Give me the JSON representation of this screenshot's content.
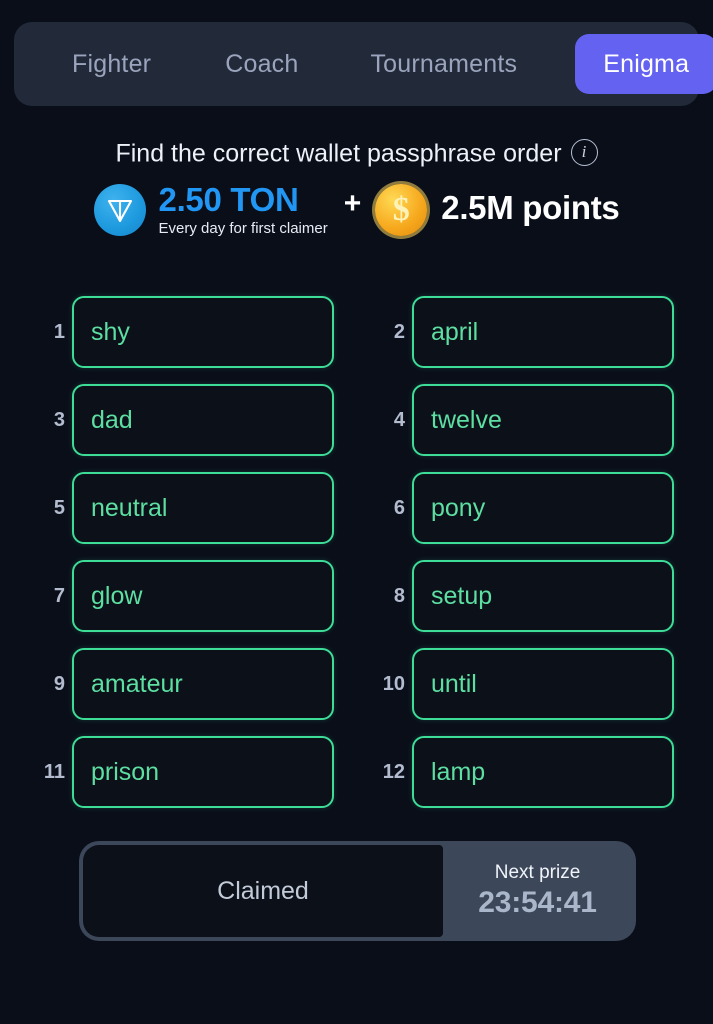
{
  "theme": {
    "background": "#0a0e19",
    "tabbar_bg": "#222a3a",
    "accent_indigo": "#6462f0",
    "accent_green": "#3ddc97",
    "word_text": "#5ddfa2",
    "ton_blue": "#2196f3",
    "coin_gold": "#f6a81d",
    "slate": "#3c4759"
  },
  "tabs": [
    {
      "label": "Fighter",
      "active": false
    },
    {
      "label": "Coach",
      "active": false
    },
    {
      "label": "Tournaments",
      "active": false
    },
    {
      "label": "Enigma",
      "active": true
    }
  ],
  "header": {
    "title": "Find the correct wallet passphrase order",
    "info_icon": "info-circle-icon"
  },
  "prize": {
    "ton_icon": "ton-coin-icon",
    "ton_amount": "2.50 TON",
    "ton_subtitle": "Every day for first claimer",
    "plus": "+",
    "coin_icon": "dollar-coin-icon",
    "points_amount": "2.5M points"
  },
  "grid": {
    "cells": [
      {
        "num": "1",
        "word": "shy"
      },
      {
        "num": "2",
        "word": "april"
      },
      {
        "num": "3",
        "word": "dad"
      },
      {
        "num": "4",
        "word": "twelve"
      },
      {
        "num": "5",
        "word": "neutral"
      },
      {
        "num": "6",
        "word": "pony"
      },
      {
        "num": "7",
        "word": "glow"
      },
      {
        "num": "8",
        "word": "setup"
      },
      {
        "num": "9",
        "word": "amateur"
      },
      {
        "num": "10",
        "word": "until"
      },
      {
        "num": "11",
        "word": "prison"
      },
      {
        "num": "12",
        "word": "lamp"
      }
    ]
  },
  "bottom": {
    "claim_label": "Claimed",
    "next_prize_label": "Next prize",
    "next_prize_time": "23:54:41"
  }
}
